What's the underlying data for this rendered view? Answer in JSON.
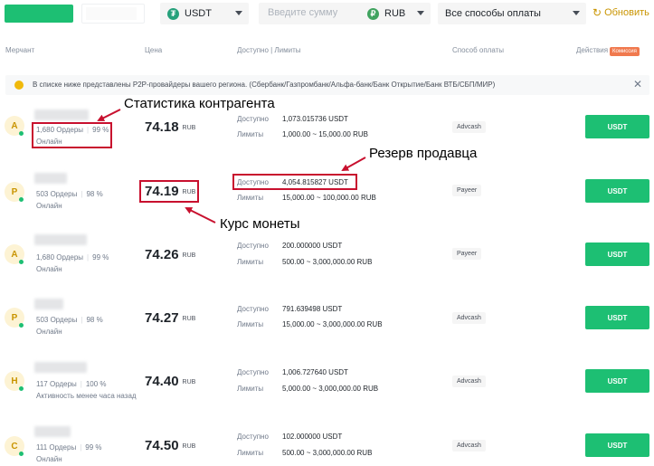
{
  "filters": {
    "coin": "USDT",
    "amount_placeholder": "Введите сумму",
    "fiat": "RUB",
    "payment_methods": "Все способы оплаты",
    "refresh": "Обновить",
    "coin_icon": "tether-icon",
    "fiat_icon": "ruble-icon",
    "refresh_icon": "refresh-icon"
  },
  "headers": {
    "merchant": "Мерчант",
    "price": "Цена",
    "available_limits": "Доступно | Лимиты",
    "payment": "Способ оплаты",
    "action": "Действия",
    "fee_badge": "Комиссия"
  },
  "notice": {
    "text": "В списке ниже представлены P2P-провайдеры вашего региона. (Сбербанк/Газпромбанк/Альфа-банк/Банк Открытие/Банк ВТБ/СБП/МИР)"
  },
  "labels": {
    "available": "Доступно",
    "limits": "Лимиты",
    "currency": "RUB",
    "buy": "USDT"
  },
  "rows": [
    {
      "avatar": "A",
      "orders": "1,680 Ордеры",
      "completion": "99 %",
      "status": "Онлайн",
      "price": "74.18",
      "available": "1,073.015736 USDT",
      "limits": "1,000.00 ~ 15,000.00 RUB",
      "payment": "Advcash"
    },
    {
      "avatar": "P",
      "orders": "503 Ордеры",
      "completion": "98 %",
      "status": "Онлайн",
      "price": "74.19",
      "available": "4,054.815827 USDT",
      "limits": "15,000.00 ~ 100,000.00 RUB",
      "payment": "Payeer"
    },
    {
      "avatar": "A",
      "orders": "1,680 Ордеры",
      "completion": "99 %",
      "status": "Онлайн",
      "price": "74.26",
      "available": "200.000000 USDT",
      "limits": "500.00 ~ 3,000,000.00 RUB",
      "payment": "Payeer"
    },
    {
      "avatar": "P",
      "orders": "503 Ордеры",
      "completion": "98 %",
      "status": "Онлайн",
      "price": "74.27",
      "available": "791.639498 USDT",
      "limits": "15,000.00 ~ 3,000,000.00 RUB",
      "payment": "Advcash"
    },
    {
      "avatar": "H",
      "orders": "117 Ордеры",
      "completion": "100 %",
      "status": "Активность менее часа назад",
      "price": "74.40",
      "available": "1,006.727640 USDT",
      "limits": "5,000.00 ~ 3,000,000.00 RUB",
      "payment": "Advcash"
    },
    {
      "avatar": "C",
      "orders": "111 Ордеры",
      "completion": "99 %",
      "status": "Онлайн",
      "price": "74.50",
      "available": "102.000000 USDT",
      "limits": "500.00 ~ 3,000,000.00 RUB",
      "payment": "Advcash"
    }
  ],
  "annotations": {
    "counterparty_stats": "Статистика контрагента",
    "seller_reserve": "Резерв продавца",
    "coin_rate": "Курс монеты"
  },
  "colors": {
    "brand_green": "#1dbf73",
    "annotation_red": "#c8102e",
    "refresh_gold": "#c99400",
    "fee_orange": "#f0794e"
  }
}
